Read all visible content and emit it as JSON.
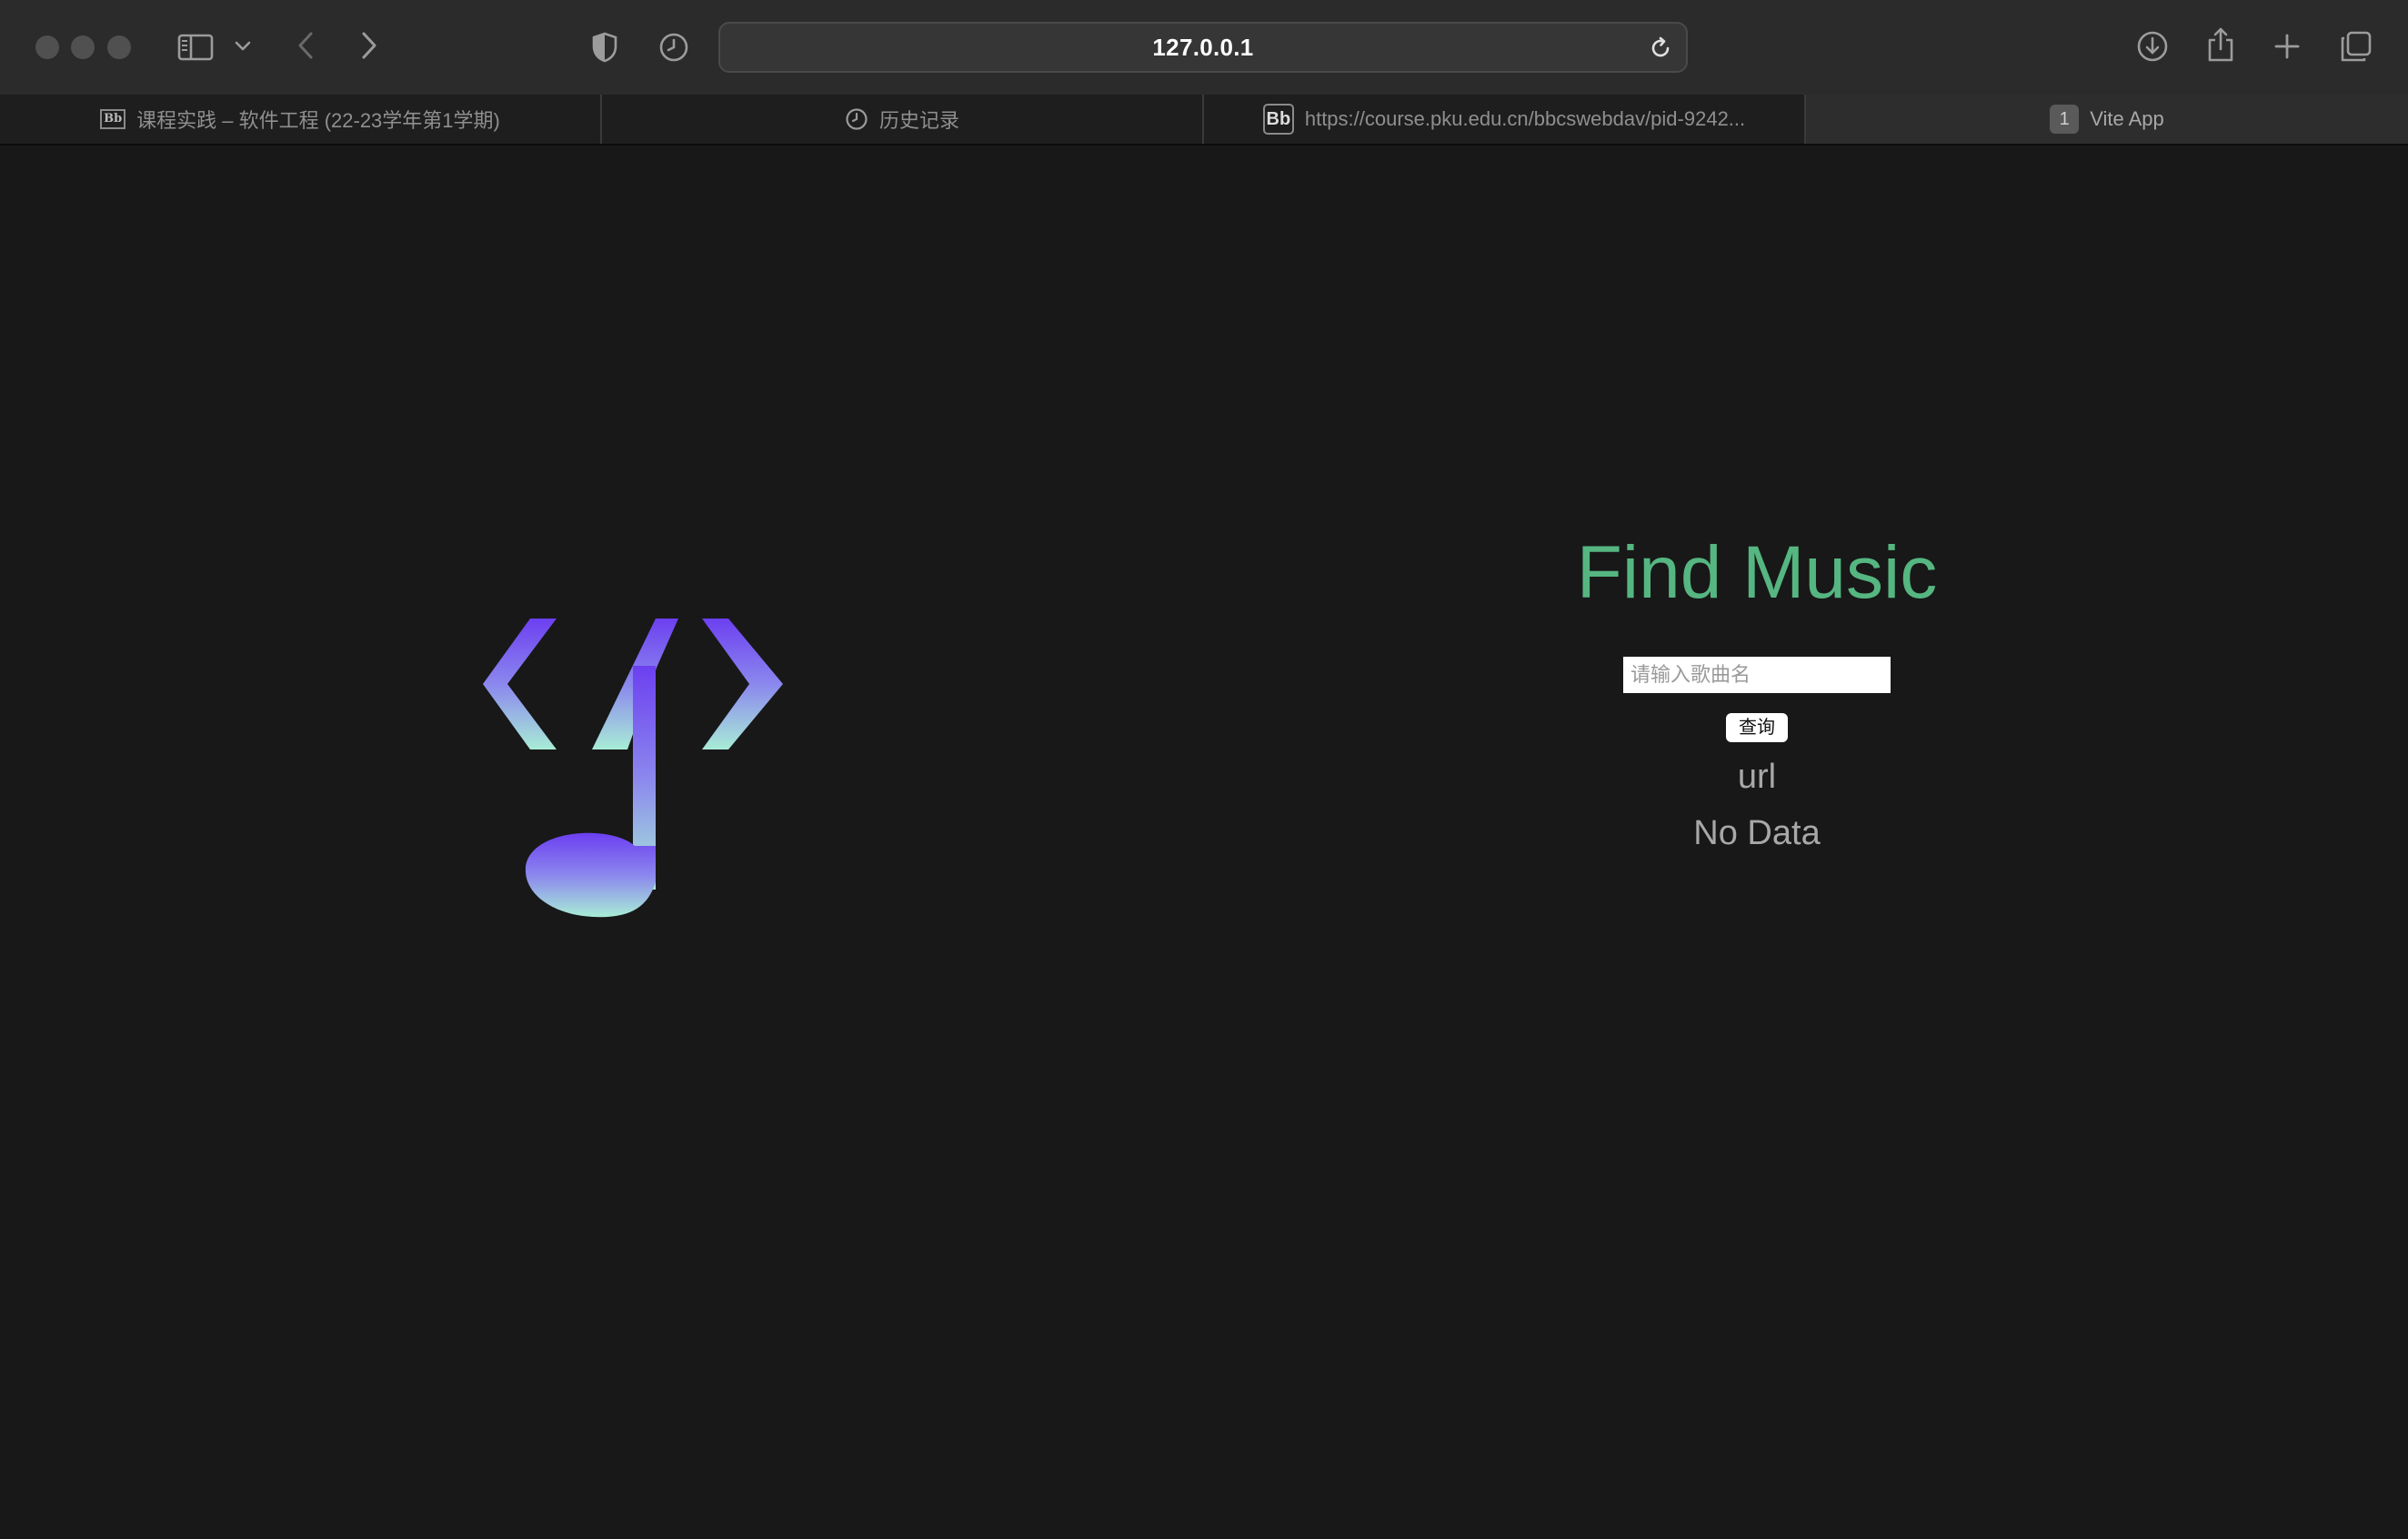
{
  "browser": {
    "address": "127.0.0.1",
    "tabs": [
      {
        "label": "课程实践 – 软件工程 (22-23学年第1学期)",
        "favicon": "blackboard-icon",
        "favicon_text": "Bb",
        "active": false
      },
      {
        "label": "历史记录",
        "favicon": "history-clock-icon",
        "active": false
      },
      {
        "label": "https://course.pku.edu.cn/bbcswebdav/pid-9242...",
        "favicon": "blackboard-icon",
        "favicon_text": "Bb",
        "active": false
      },
      {
        "label": "Vite App",
        "favicon": "number-badge",
        "favicon_text": "1",
        "active": true
      }
    ],
    "toolbar_icons": [
      "sidebar-icon",
      "chevron-down-icon",
      "back-icon",
      "forward-icon",
      "shield-icon",
      "history-icon",
      "reload-icon",
      "download-icon",
      "share-icon",
      "new-tab-icon",
      "tab-overview-icon"
    ]
  },
  "app": {
    "title": "Find Music",
    "search_placeholder": "请输入歌曲名",
    "search_value": "",
    "query_button": "查询",
    "url_label": "url",
    "result_text": "No Data",
    "colors": {
      "title": "#56b681",
      "background": "#181818",
      "logo_gradient_top": "#6c3ff0",
      "logo_gradient_bottom": "#a8ecd6"
    }
  }
}
